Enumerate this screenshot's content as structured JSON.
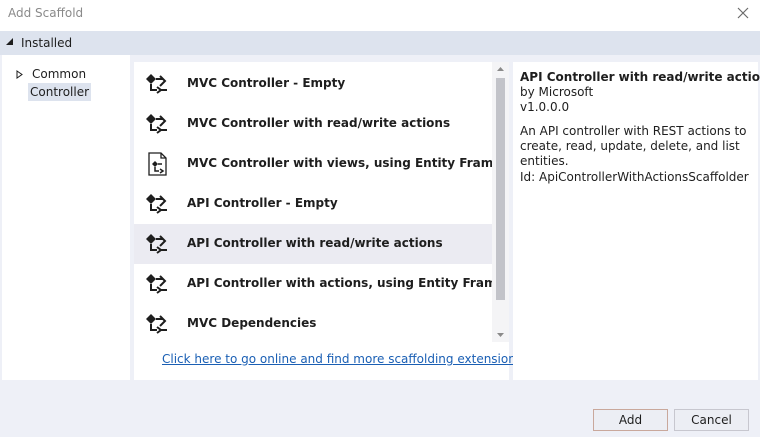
{
  "window": {
    "title": "Add Scaffold"
  },
  "header": {
    "label": "Installed"
  },
  "tree": {
    "items": [
      {
        "label": "Common"
      },
      {
        "label": "Controller"
      }
    ]
  },
  "list": {
    "selected_index": 4,
    "items": [
      {
        "label": "MVC Controller - Empty",
        "icon": "controller-icon"
      },
      {
        "label": "MVC Controller with read/write actions",
        "icon": "controller-icon"
      },
      {
        "label": "MVC Controller with views, using Entity Framework",
        "icon": "controller-views-icon"
      },
      {
        "label": "API Controller - Empty",
        "icon": "controller-icon"
      },
      {
        "label": "API Controller with read/write actions",
        "icon": "controller-icon"
      },
      {
        "label": "API Controller with actions, using Entity Framework",
        "icon": "controller-icon"
      },
      {
        "label": "MVC Dependencies",
        "icon": "controller-icon"
      }
    ]
  },
  "link": {
    "online": "Click here to go online and find more scaffolding extensions."
  },
  "details": {
    "title": "API Controller with read/write actions",
    "author": "by Microsoft",
    "version": "v1.0.0.0",
    "description": "An API controller with REST actions to create, read, update, delete, and list entities.",
    "id": "Id: ApiControllerWithActionsScaffolder"
  },
  "buttons": {
    "add": "Add",
    "cancel": "Cancel"
  },
  "colors": {
    "accent": "#1a5fb4",
    "header_bg": "#dde3ee",
    "selection_bg": "#ebebf2"
  }
}
